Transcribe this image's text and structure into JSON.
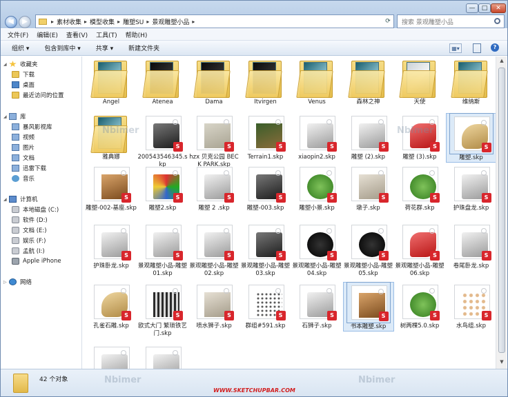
{
  "address": {
    "crumbs": [
      "素材收集",
      "模型收集",
      "雕塑SU",
      "景观雕塑小品"
    ],
    "search_placeholder": "搜索 景观雕塑小品"
  },
  "window_controls": {
    "minimize": "—",
    "maximize": "□",
    "close": "✕"
  },
  "menu": [
    "文件(F)",
    "编辑(E)",
    "查看(V)",
    "工具(T)",
    "帮助(H)"
  ],
  "toolbar": [
    "组织 ▾",
    "包含到库中 ▾",
    "共享 ▾",
    "新建文件夹"
  ],
  "sidebar": {
    "favorites_title": "收藏夹",
    "favorites": [
      "下载",
      "桌面",
      "最近访问的位置"
    ],
    "libraries_title": "库",
    "libraries": [
      "暴风影视库",
      "视频",
      "图片",
      "文档",
      "迅雷下载",
      "音乐"
    ],
    "computer_title": "计算机",
    "drives": [
      "本地磁盘 (C:)",
      "软件 (D:)",
      "文档 (E:)",
      "娱乐 (F:)",
      "孟航 (I:)",
      "Apple iPhone"
    ],
    "network": "网络"
  },
  "files": [
    {
      "name": "Angel",
      "kind": "folder",
      "doc": "teal"
    },
    {
      "name": "Atenea",
      "kind": "folder",
      "doc": "dark"
    },
    {
      "name": "Dama",
      "kind": "folder",
      "doc": "dark"
    },
    {
      "name": "Itvirgen",
      "kind": "folder",
      "doc": "dark"
    },
    {
      "name": "Venus",
      "kind": "folder",
      "doc": "teal"
    },
    {
      "name": "森林之神",
      "kind": "folder",
      "doc": "teal"
    },
    {
      "name": "天使",
      "kind": "folder",
      "doc": "light"
    },
    {
      "name": "维纳斯",
      "kind": "folder",
      "doc": "teal"
    },
    {
      "name": "雅典娜",
      "kind": "folder",
      "doc": "teal"
    },
    {
      "name": "200543546345.skp",
      "kind": "skp",
      "model": "m-dark"
    },
    {
      "name": "hzx 贝克公园 BECK PARK.skp",
      "kind": "skp",
      "model": "m-map"
    },
    {
      "name": "Terrain1.skp",
      "kind": "skp",
      "model": "m-photo"
    },
    {
      "name": "xiaopin2.skp",
      "kind": "skp",
      "model": "m-gray"
    },
    {
      "name": "雕塑 (2).skp",
      "kind": "skp",
      "model": "m-gray"
    },
    {
      "name": "雕塑 (3).skp",
      "kind": "skp",
      "model": "m-red"
    },
    {
      "name": "雕塑.skp",
      "kind": "skp",
      "model": "m-gold",
      "selected": true
    },
    {
      "name": "雕塑-002-基座.skp",
      "kind": "skp",
      "model": "m-wood"
    },
    {
      "name": "雕塑2.skp",
      "kind": "skp",
      "model": "m-colors"
    },
    {
      "name": "雕塑 2 .skp",
      "kind": "skp",
      "model": "m-gray"
    },
    {
      "name": "雕塑-003.skp",
      "kind": "skp",
      "model": "m-dark"
    },
    {
      "name": "雕塑小景.skp",
      "kind": "skp",
      "model": "m-green"
    },
    {
      "name": "墩子.skp",
      "kind": "skp",
      "model": "m-stone"
    },
    {
      "name": "荷花群.skp",
      "kind": "skp",
      "model": "m-green"
    },
    {
      "name": "护珠盘龙.skp",
      "kind": "skp",
      "model": "m-gray"
    },
    {
      "name": "护珠卧龙.skp",
      "kind": "skp",
      "model": "m-gray"
    },
    {
      "name": "景观雕塑小品-雕塑01.skp",
      "kind": "skp",
      "model": "m-gray"
    },
    {
      "name": "景观雕塑小品-雕塑02.skp",
      "kind": "skp",
      "model": "m-gray"
    },
    {
      "name": "景观雕塑小品-雕塑03.skp",
      "kind": "skp",
      "model": "m-dark"
    },
    {
      "name": "景观雕塑小品-雕塑04.skp",
      "kind": "skp",
      "model": "m-black"
    },
    {
      "name": "景观雕塑小品-雕塑05.skp",
      "kind": "skp",
      "model": "m-black"
    },
    {
      "name": "景观雕塑小品-雕塑06.skp",
      "kind": "skp",
      "model": "m-red"
    },
    {
      "name": "卷尾卧龙.skp",
      "kind": "skp",
      "model": "m-gray"
    },
    {
      "name": "孔雀石雕.skp",
      "kind": "skp",
      "model": "m-gold"
    },
    {
      "name": "欧式大门 繁琐铁艺门.skp",
      "kind": "skp",
      "model": "m-gate"
    },
    {
      "name": "喷水狮子.skp",
      "kind": "skp",
      "model": "m-stone"
    },
    {
      "name": "群组#591.skp",
      "kind": "skp",
      "model": "m-dots"
    },
    {
      "name": "石狮子.skp",
      "kind": "skp",
      "model": "m-gray"
    },
    {
      "name": "书本雕塑.skp",
      "kind": "skp",
      "model": "m-wood",
      "selected": true
    },
    {
      "name": "树两棵5.0.skp",
      "kind": "skp",
      "model": "m-green"
    },
    {
      "name": "水鸟组.skp",
      "kind": "skp",
      "model": "m-flowers"
    },
    {
      "name": "",
      "kind": "skp",
      "model": "m-gray"
    },
    {
      "name": "",
      "kind": "skp",
      "model": "m-gray"
    }
  ],
  "status": {
    "count": "42 个对象"
  },
  "watermarks": {
    "brand": "Nbimer",
    "site": "WWW.SKETCHUPBAR.COM"
  }
}
